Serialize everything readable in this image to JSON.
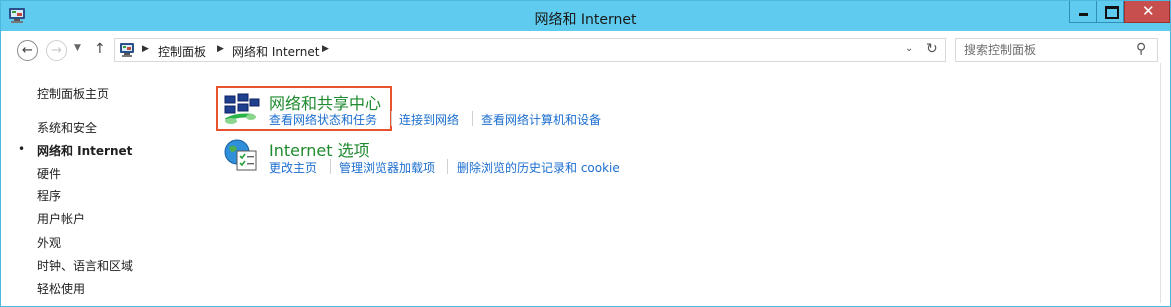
{
  "window": {
    "title": "网络和 Internet",
    "controls": {
      "minimize": "minimize",
      "maximize": "maximize",
      "close": "✕"
    }
  },
  "address_bar": {
    "crumbs": [
      "控制面板",
      "网络和 Internet"
    ],
    "dropdown_glyph": "⌄",
    "refresh_glyph": "↻",
    "up_glyph": "↑",
    "back_glyph": "←",
    "forward_glyph": "→",
    "recent_glyph": "▼"
  },
  "search": {
    "placeholder": "搜索控制面板",
    "value": "",
    "icon": "search-icon"
  },
  "sidebar": {
    "home": "控制面板主页",
    "items": [
      {
        "label": "系统和安全",
        "current": false
      },
      {
        "label": "网络和 Internet",
        "current": true
      },
      {
        "label": "硬件",
        "current": false
      },
      {
        "label": "程序",
        "current": false
      },
      {
        "label": "用户帐户",
        "current": false
      },
      {
        "label": "外观",
        "current": false
      },
      {
        "label": "时钟、语言和区域",
        "current": false
      },
      {
        "label": "轻松使用",
        "current": false
      }
    ],
    "bullet": "•"
  },
  "categories": [
    {
      "title": "网络和共享中心",
      "icon": "network-sharing-center-icon",
      "highlighted": true,
      "links": [
        "查看网络状态和任务",
        "连接到网络",
        "查看网络计算机和设备"
      ]
    },
    {
      "title": "Internet 选项",
      "icon": "internet-options-icon",
      "highlighted": false,
      "links": [
        "更改主页",
        "管理浏览器加载项",
        "删除浏览的历史记录和 cookie"
      ]
    }
  ],
  "colors": {
    "titlebar": "#5ecbef",
    "close_button": "#c7504f",
    "category_title": "#1e8a2e",
    "link": "#1b6ecf",
    "highlight_border": "#e8522e"
  }
}
